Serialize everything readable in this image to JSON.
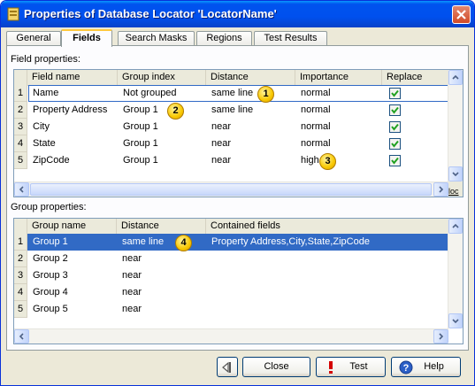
{
  "window": {
    "title": "Properties of Database Locator 'LocatorName'",
    "close_icon": "close-icon"
  },
  "tabs": [
    {
      "label": "General"
    },
    {
      "label": "Fields"
    },
    {
      "label": "Search Masks"
    },
    {
      "label": "Regions"
    },
    {
      "label": "Test Results"
    }
  ],
  "field_properties": {
    "label": "Field properties:",
    "headers": [
      "Field name",
      "Group index",
      "Distance",
      "Importance",
      "Replace"
    ],
    "rows": [
      {
        "num": "1",
        "name": "Name",
        "group": "Not grouped",
        "distance": "same line",
        "importance": "normal",
        "replace": true
      },
      {
        "num": "2",
        "name": "Property Address",
        "group": "Group 1",
        "distance": "same line",
        "importance": "normal",
        "replace": true
      },
      {
        "num": "3",
        "name": "City",
        "group": "Group 1",
        "distance": "near",
        "importance": "normal",
        "replace": true
      },
      {
        "num": "4",
        "name": "State",
        "group": "Group 1",
        "distance": "near",
        "importance": "normal",
        "replace": true
      },
      {
        "num": "5",
        "name": "ZipCode",
        "group": "Group 1",
        "distance": "near",
        "importance": "high",
        "replace": true
      }
    ],
    "clipped_column_text": "loc"
  },
  "group_properties": {
    "label": "Group properties:",
    "headers": [
      "Group name",
      "Distance",
      "Contained fields"
    ],
    "rows": [
      {
        "num": "1",
        "name": "Group 1",
        "distance": "same line",
        "fields": "Property Address,City,State,ZipCode"
      },
      {
        "num": "2",
        "name": "Group 2",
        "distance": "near",
        "fields": ""
      },
      {
        "num": "3",
        "name": "Group 3",
        "distance": "near",
        "fields": ""
      },
      {
        "num": "4",
        "name": "Group 4",
        "distance": "near",
        "fields": ""
      },
      {
        "num": "5",
        "name": "Group 5",
        "distance": "near",
        "fields": ""
      }
    ]
  },
  "callouts": [
    "1",
    "2",
    "3",
    "4"
  ],
  "buttons": {
    "back_icon": "back-arrow-icon",
    "close": "Close",
    "test": "Test",
    "help": "Help"
  },
  "colors": {
    "selection": "#316ac5",
    "title_bar": "#0053ee",
    "callout": "#f8c800"
  }
}
